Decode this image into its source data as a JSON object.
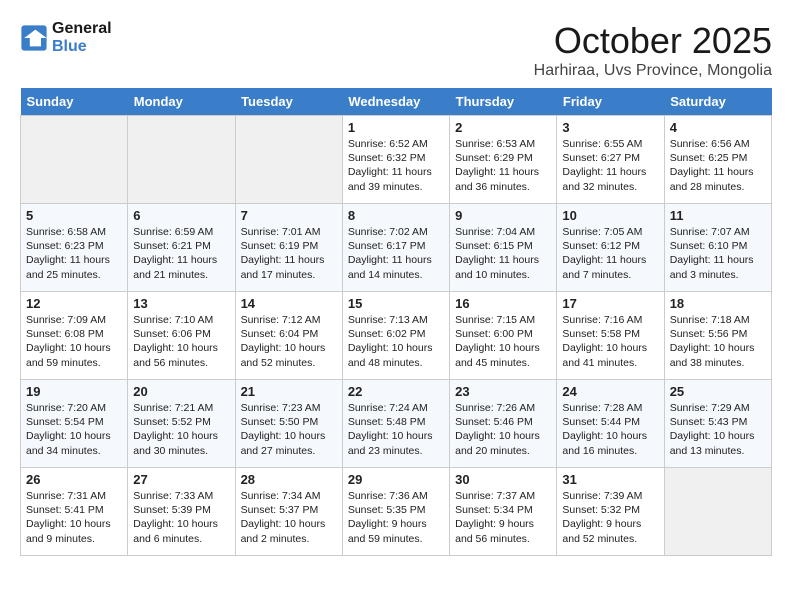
{
  "header": {
    "logo_line1": "General",
    "logo_line2": "Blue",
    "month_title": "October 2025",
    "location": "Harhiraa, Uvs Province, Mongolia"
  },
  "days_of_week": [
    "Sunday",
    "Monday",
    "Tuesday",
    "Wednesday",
    "Thursday",
    "Friday",
    "Saturday"
  ],
  "weeks": [
    [
      {
        "day": "",
        "content": ""
      },
      {
        "day": "",
        "content": ""
      },
      {
        "day": "",
        "content": ""
      },
      {
        "day": "1",
        "content": "Sunrise: 6:52 AM\nSunset: 6:32 PM\nDaylight: 11 hours\nand 39 minutes."
      },
      {
        "day": "2",
        "content": "Sunrise: 6:53 AM\nSunset: 6:29 PM\nDaylight: 11 hours\nand 36 minutes."
      },
      {
        "day": "3",
        "content": "Sunrise: 6:55 AM\nSunset: 6:27 PM\nDaylight: 11 hours\nand 32 minutes."
      },
      {
        "day": "4",
        "content": "Sunrise: 6:56 AM\nSunset: 6:25 PM\nDaylight: 11 hours\nand 28 minutes."
      }
    ],
    [
      {
        "day": "5",
        "content": "Sunrise: 6:58 AM\nSunset: 6:23 PM\nDaylight: 11 hours\nand 25 minutes."
      },
      {
        "day": "6",
        "content": "Sunrise: 6:59 AM\nSunset: 6:21 PM\nDaylight: 11 hours\nand 21 minutes."
      },
      {
        "day": "7",
        "content": "Sunrise: 7:01 AM\nSunset: 6:19 PM\nDaylight: 11 hours\nand 17 minutes."
      },
      {
        "day": "8",
        "content": "Sunrise: 7:02 AM\nSunset: 6:17 PM\nDaylight: 11 hours\nand 14 minutes."
      },
      {
        "day": "9",
        "content": "Sunrise: 7:04 AM\nSunset: 6:15 PM\nDaylight: 11 hours\nand 10 minutes."
      },
      {
        "day": "10",
        "content": "Sunrise: 7:05 AM\nSunset: 6:12 PM\nDaylight: 11 hours\nand 7 minutes."
      },
      {
        "day": "11",
        "content": "Sunrise: 7:07 AM\nSunset: 6:10 PM\nDaylight: 11 hours\nand 3 minutes."
      }
    ],
    [
      {
        "day": "12",
        "content": "Sunrise: 7:09 AM\nSunset: 6:08 PM\nDaylight: 10 hours\nand 59 minutes."
      },
      {
        "day": "13",
        "content": "Sunrise: 7:10 AM\nSunset: 6:06 PM\nDaylight: 10 hours\nand 56 minutes."
      },
      {
        "day": "14",
        "content": "Sunrise: 7:12 AM\nSunset: 6:04 PM\nDaylight: 10 hours\nand 52 minutes."
      },
      {
        "day": "15",
        "content": "Sunrise: 7:13 AM\nSunset: 6:02 PM\nDaylight: 10 hours\nand 48 minutes."
      },
      {
        "day": "16",
        "content": "Sunrise: 7:15 AM\nSunset: 6:00 PM\nDaylight: 10 hours\nand 45 minutes."
      },
      {
        "day": "17",
        "content": "Sunrise: 7:16 AM\nSunset: 5:58 PM\nDaylight: 10 hours\nand 41 minutes."
      },
      {
        "day": "18",
        "content": "Sunrise: 7:18 AM\nSunset: 5:56 PM\nDaylight: 10 hours\nand 38 minutes."
      }
    ],
    [
      {
        "day": "19",
        "content": "Sunrise: 7:20 AM\nSunset: 5:54 PM\nDaylight: 10 hours\nand 34 minutes."
      },
      {
        "day": "20",
        "content": "Sunrise: 7:21 AM\nSunset: 5:52 PM\nDaylight: 10 hours\nand 30 minutes."
      },
      {
        "day": "21",
        "content": "Sunrise: 7:23 AM\nSunset: 5:50 PM\nDaylight: 10 hours\nand 27 minutes."
      },
      {
        "day": "22",
        "content": "Sunrise: 7:24 AM\nSunset: 5:48 PM\nDaylight: 10 hours\nand 23 minutes."
      },
      {
        "day": "23",
        "content": "Sunrise: 7:26 AM\nSunset: 5:46 PM\nDaylight: 10 hours\nand 20 minutes."
      },
      {
        "day": "24",
        "content": "Sunrise: 7:28 AM\nSunset: 5:44 PM\nDaylight: 10 hours\nand 16 minutes."
      },
      {
        "day": "25",
        "content": "Sunrise: 7:29 AM\nSunset: 5:43 PM\nDaylight: 10 hours\nand 13 minutes."
      }
    ],
    [
      {
        "day": "26",
        "content": "Sunrise: 7:31 AM\nSunset: 5:41 PM\nDaylight: 10 hours\nand 9 minutes."
      },
      {
        "day": "27",
        "content": "Sunrise: 7:33 AM\nSunset: 5:39 PM\nDaylight: 10 hours\nand 6 minutes."
      },
      {
        "day": "28",
        "content": "Sunrise: 7:34 AM\nSunset: 5:37 PM\nDaylight: 10 hours\nand 2 minutes."
      },
      {
        "day": "29",
        "content": "Sunrise: 7:36 AM\nSunset: 5:35 PM\nDaylight: 9 hours\nand 59 minutes."
      },
      {
        "day": "30",
        "content": "Sunrise: 7:37 AM\nSunset: 5:34 PM\nDaylight: 9 hours\nand 56 minutes."
      },
      {
        "day": "31",
        "content": "Sunrise: 7:39 AM\nSunset: 5:32 PM\nDaylight: 9 hours\nand 52 minutes."
      },
      {
        "day": "",
        "content": ""
      }
    ]
  ]
}
